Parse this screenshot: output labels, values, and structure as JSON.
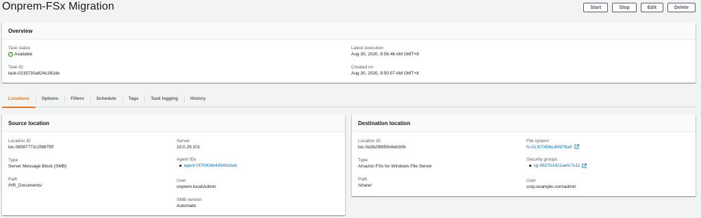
{
  "header": {
    "title": "Onprem-FSx Migration",
    "buttons": {
      "start": "Start",
      "stop": "Stop",
      "edit": "Edit",
      "delete": "Delete"
    }
  },
  "overview": {
    "title": "Overview",
    "task_status_label": "Task status",
    "task_status_value": "Available",
    "task_id_label": "Task ID",
    "task_id_value": "task-0219730a824c392de",
    "latest_execution_label": "Latest execution",
    "latest_execution_value": "Aug 30, 2020, 9:56:46 AM GMT+8",
    "created_on_label": "Created on",
    "created_on_value": "Aug 30, 2020, 9:50:07 AM GMT+8"
  },
  "tabs": [
    "Locations",
    "Options",
    "Filters",
    "Schedule",
    "Tags",
    "Task logging",
    "History"
  ],
  "source": {
    "title": "Source location",
    "location_id_label": "Location ID",
    "location_id_value": "loc-06087772c2f9875ff",
    "type_label": "Type",
    "type_value": "Server Message Block (SMB)",
    "path_label": "Path",
    "path_value": "/HR_Documents/",
    "server_label": "Server",
    "server_value": "10.0.29.101",
    "agent_ids_label": "Agent IDs",
    "agent_ids_value": "agent-0f7090db43940cbab",
    "user_label": "User",
    "user_value": "onprem.local\\Admin",
    "smb_version_label": "SMB version",
    "smb_version_value": "Automatic"
  },
  "destination": {
    "title": "Destination location",
    "location_id_label": "Location ID",
    "location_id_value": "loc-0a3b2f6959c6eb30b",
    "type_label": "Type",
    "type_value": "Amazon FSx for Windows File Server",
    "path_label": "Path",
    "path_value": "/share/",
    "file_system_label": "File system",
    "file_system_value": "fs-01307456cdf4978a0",
    "security_groups_label": "Security groups",
    "security_groups_value": "sg-0827b1421aefc7e11",
    "user_label": "User",
    "user_value": "corp.example.com\\admin"
  },
  "colors": {
    "link": "#0073bb",
    "active_tab": "#ec7211",
    "status_ok": "#1d8102"
  },
  "icons": {
    "status": "check-circle-icon",
    "external": "external-link-icon"
  }
}
